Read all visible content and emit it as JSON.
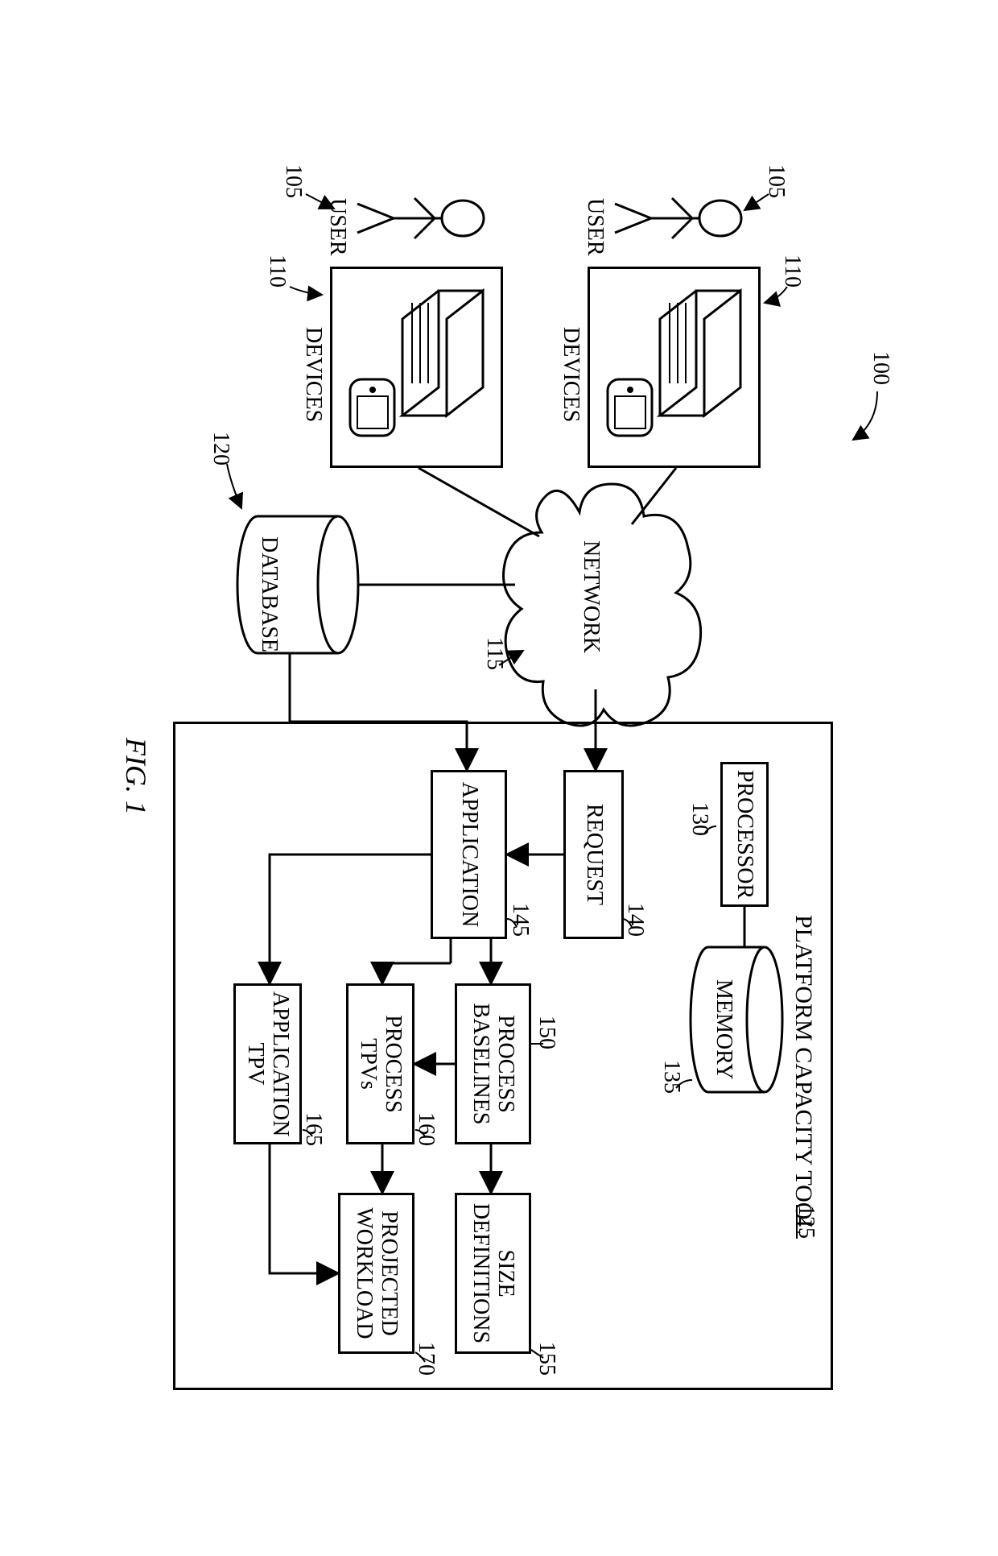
{
  "figure_label": "FIG. 1",
  "system_ref": "100",
  "users": [
    {
      "label": "USER",
      "ref": "105",
      "devices_label": "DEVICES",
      "devices_ref": "110"
    },
    {
      "label": "USER",
      "ref": "105",
      "devices_label": "DEVICES",
      "devices_ref": "110"
    }
  ],
  "network": {
    "label": "NETWORK",
    "ref": "115"
  },
  "database": {
    "label": "DATABASE",
    "ref": "120"
  },
  "tool": {
    "title": "PLATFORM CAPACITY TOOL",
    "ref": "125",
    "processor": {
      "label": "PROCESSOR",
      "ref": "130"
    },
    "memory": {
      "label": "MEMORY",
      "ref": "135"
    },
    "request": {
      "label": "REQUEST",
      "ref": "140"
    },
    "application": {
      "label": "APPLICATION",
      "ref": "145"
    },
    "process_baselines": {
      "label": "PROCESS BASELINES",
      "ref": "150"
    },
    "size_definitions": {
      "label": "SIZE DEFINITIONS",
      "ref": "155"
    },
    "process_tpvs": {
      "label": "PROCESS TPVs",
      "ref": "160"
    },
    "application_tpv": {
      "label": "APPLICATION TPV",
      "ref": "165"
    },
    "projected_workload": {
      "label": "PROJECTED WORKLOAD",
      "ref": "170"
    }
  }
}
